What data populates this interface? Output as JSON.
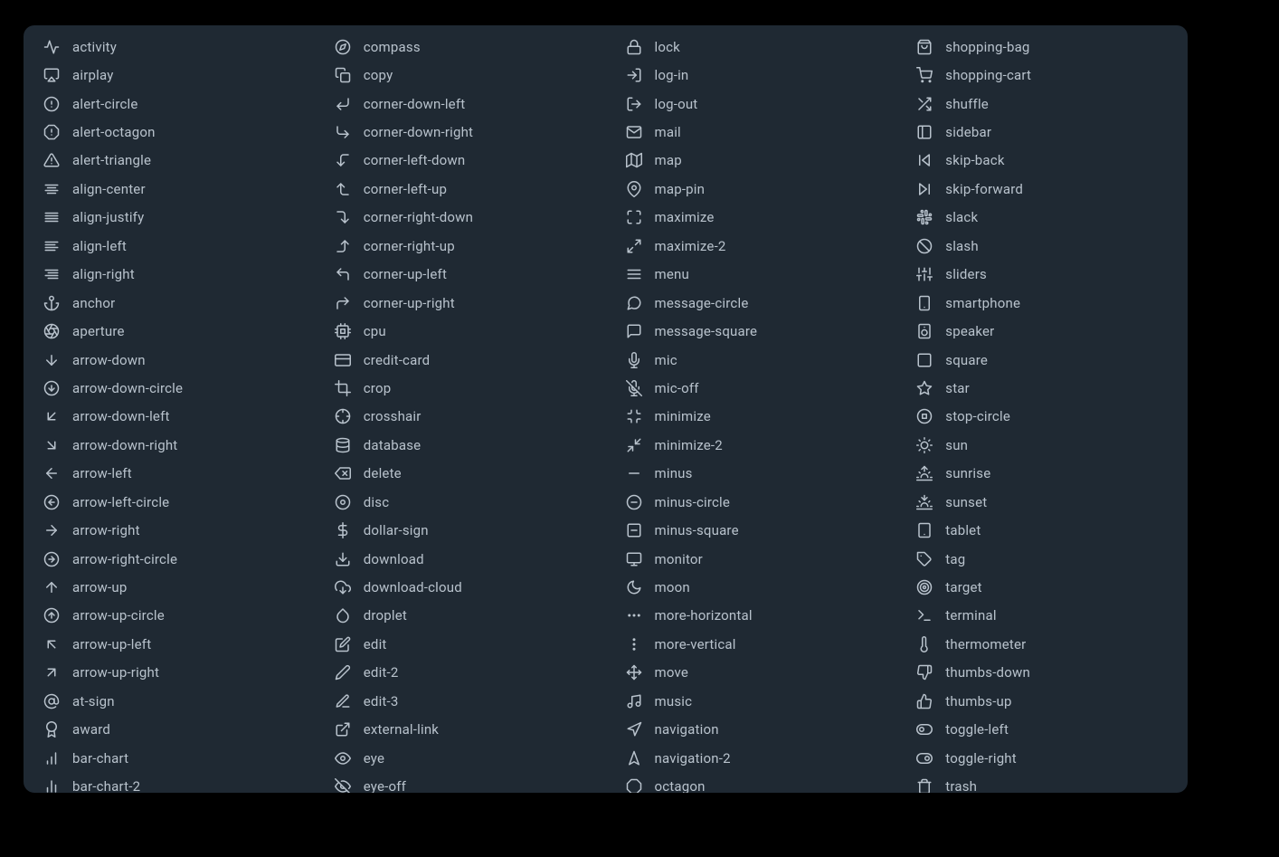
{
  "columns": [
    [
      {
        "id": "activity",
        "label": "activity"
      },
      {
        "id": "airplay",
        "label": "airplay"
      },
      {
        "id": "alert-circle",
        "label": "alert-circle"
      },
      {
        "id": "alert-octagon",
        "label": "alert-octagon"
      },
      {
        "id": "alert-triangle",
        "label": "alert-triangle"
      },
      {
        "id": "align-center",
        "label": "align-center"
      },
      {
        "id": "align-justify",
        "label": "align-justify"
      },
      {
        "id": "align-left",
        "label": "align-left"
      },
      {
        "id": "align-right",
        "label": "align-right"
      },
      {
        "id": "anchor",
        "label": "anchor"
      },
      {
        "id": "aperture",
        "label": "aperture"
      },
      {
        "id": "arrow-down",
        "label": "arrow-down"
      },
      {
        "id": "arrow-down-circle",
        "label": "arrow-down-circle"
      },
      {
        "id": "arrow-down-left",
        "label": "arrow-down-left"
      },
      {
        "id": "arrow-down-right",
        "label": "arrow-down-right"
      },
      {
        "id": "arrow-left",
        "label": "arrow-left"
      },
      {
        "id": "arrow-left-circle",
        "label": "arrow-left-circle"
      },
      {
        "id": "arrow-right",
        "label": "arrow-right"
      },
      {
        "id": "arrow-right-circle",
        "label": "arrow-right-circle"
      },
      {
        "id": "arrow-up",
        "label": "arrow-up"
      },
      {
        "id": "arrow-up-circle",
        "label": "arrow-up-circle"
      },
      {
        "id": "arrow-up-left",
        "label": "arrow-up-left"
      },
      {
        "id": "arrow-up-right",
        "label": "arrow-up-right"
      },
      {
        "id": "at-sign",
        "label": "at-sign"
      },
      {
        "id": "award",
        "label": "award"
      },
      {
        "id": "bar-chart",
        "label": "bar-chart"
      },
      {
        "id": "bar-chart-2",
        "label": "bar-chart-2"
      }
    ],
    [
      {
        "id": "compass",
        "label": "compass"
      },
      {
        "id": "copy",
        "label": "copy"
      },
      {
        "id": "corner-down-left",
        "label": "corner-down-left"
      },
      {
        "id": "corner-down-right",
        "label": "corner-down-right"
      },
      {
        "id": "corner-left-down",
        "label": "corner-left-down"
      },
      {
        "id": "corner-left-up",
        "label": "corner-left-up"
      },
      {
        "id": "corner-right-down",
        "label": "corner-right-down"
      },
      {
        "id": "corner-right-up",
        "label": "corner-right-up"
      },
      {
        "id": "corner-up-left",
        "label": "corner-up-left"
      },
      {
        "id": "corner-up-right",
        "label": "corner-up-right"
      },
      {
        "id": "cpu",
        "label": "cpu"
      },
      {
        "id": "credit-card",
        "label": "credit-card"
      },
      {
        "id": "crop",
        "label": "crop"
      },
      {
        "id": "crosshair",
        "label": "crosshair"
      },
      {
        "id": "database",
        "label": "database"
      },
      {
        "id": "delete",
        "label": "delete"
      },
      {
        "id": "disc",
        "label": "disc"
      },
      {
        "id": "dollar-sign",
        "label": "dollar-sign"
      },
      {
        "id": "download",
        "label": "download"
      },
      {
        "id": "download-cloud",
        "label": "download-cloud"
      },
      {
        "id": "droplet",
        "label": "droplet"
      },
      {
        "id": "edit",
        "label": "edit"
      },
      {
        "id": "edit-2",
        "label": "edit-2"
      },
      {
        "id": "edit-3",
        "label": "edit-3"
      },
      {
        "id": "external-link",
        "label": "external-link"
      },
      {
        "id": "eye",
        "label": "eye"
      },
      {
        "id": "eye-off",
        "label": "eye-off"
      }
    ],
    [
      {
        "id": "lock",
        "label": "lock"
      },
      {
        "id": "log-in",
        "label": "log-in"
      },
      {
        "id": "log-out",
        "label": "log-out"
      },
      {
        "id": "mail",
        "label": "mail"
      },
      {
        "id": "map",
        "label": "map"
      },
      {
        "id": "map-pin",
        "label": "map-pin"
      },
      {
        "id": "maximize",
        "label": "maximize"
      },
      {
        "id": "maximize-2",
        "label": "maximize-2"
      },
      {
        "id": "menu",
        "label": "menu"
      },
      {
        "id": "message-circle",
        "label": "message-circle"
      },
      {
        "id": "message-square",
        "label": "message-square"
      },
      {
        "id": "mic",
        "label": "mic"
      },
      {
        "id": "mic-off",
        "label": "mic-off"
      },
      {
        "id": "minimize",
        "label": "minimize"
      },
      {
        "id": "minimize-2",
        "label": "minimize-2"
      },
      {
        "id": "minus",
        "label": "minus"
      },
      {
        "id": "minus-circle",
        "label": "minus-circle"
      },
      {
        "id": "minus-square",
        "label": "minus-square"
      },
      {
        "id": "monitor",
        "label": "monitor"
      },
      {
        "id": "moon",
        "label": "moon"
      },
      {
        "id": "more-horizontal",
        "label": "more-horizontal"
      },
      {
        "id": "more-vertical",
        "label": "more-vertical"
      },
      {
        "id": "move",
        "label": "move"
      },
      {
        "id": "music",
        "label": "music"
      },
      {
        "id": "navigation",
        "label": "navigation"
      },
      {
        "id": "navigation-2",
        "label": "navigation-2"
      },
      {
        "id": "octagon",
        "label": "octagon"
      }
    ],
    [
      {
        "id": "shopping-bag",
        "label": "shopping-bag"
      },
      {
        "id": "shopping-cart",
        "label": "shopping-cart"
      },
      {
        "id": "shuffle",
        "label": "shuffle"
      },
      {
        "id": "sidebar",
        "label": "sidebar"
      },
      {
        "id": "skip-back",
        "label": "skip-back"
      },
      {
        "id": "skip-forward",
        "label": "skip-forward"
      },
      {
        "id": "slack",
        "label": "slack"
      },
      {
        "id": "slash",
        "label": "slash"
      },
      {
        "id": "sliders",
        "label": "sliders"
      },
      {
        "id": "smartphone",
        "label": "smartphone"
      },
      {
        "id": "speaker",
        "label": "speaker"
      },
      {
        "id": "square",
        "label": "square"
      },
      {
        "id": "star",
        "label": "star"
      },
      {
        "id": "stop-circle",
        "label": "stop-circle"
      },
      {
        "id": "sun",
        "label": "sun"
      },
      {
        "id": "sunrise",
        "label": "sunrise"
      },
      {
        "id": "sunset",
        "label": "sunset"
      },
      {
        "id": "tablet",
        "label": "tablet"
      },
      {
        "id": "tag",
        "label": "tag"
      },
      {
        "id": "target",
        "label": "target"
      },
      {
        "id": "terminal",
        "label": "terminal"
      },
      {
        "id": "thermometer",
        "label": "thermometer"
      },
      {
        "id": "thumbs-down",
        "label": "thumbs-down"
      },
      {
        "id": "thumbs-up",
        "label": "thumbs-up"
      },
      {
        "id": "toggle-left",
        "label": "toggle-left"
      },
      {
        "id": "toggle-right",
        "label": "toggle-right"
      },
      {
        "id": "trash",
        "label": "trash"
      }
    ]
  ]
}
